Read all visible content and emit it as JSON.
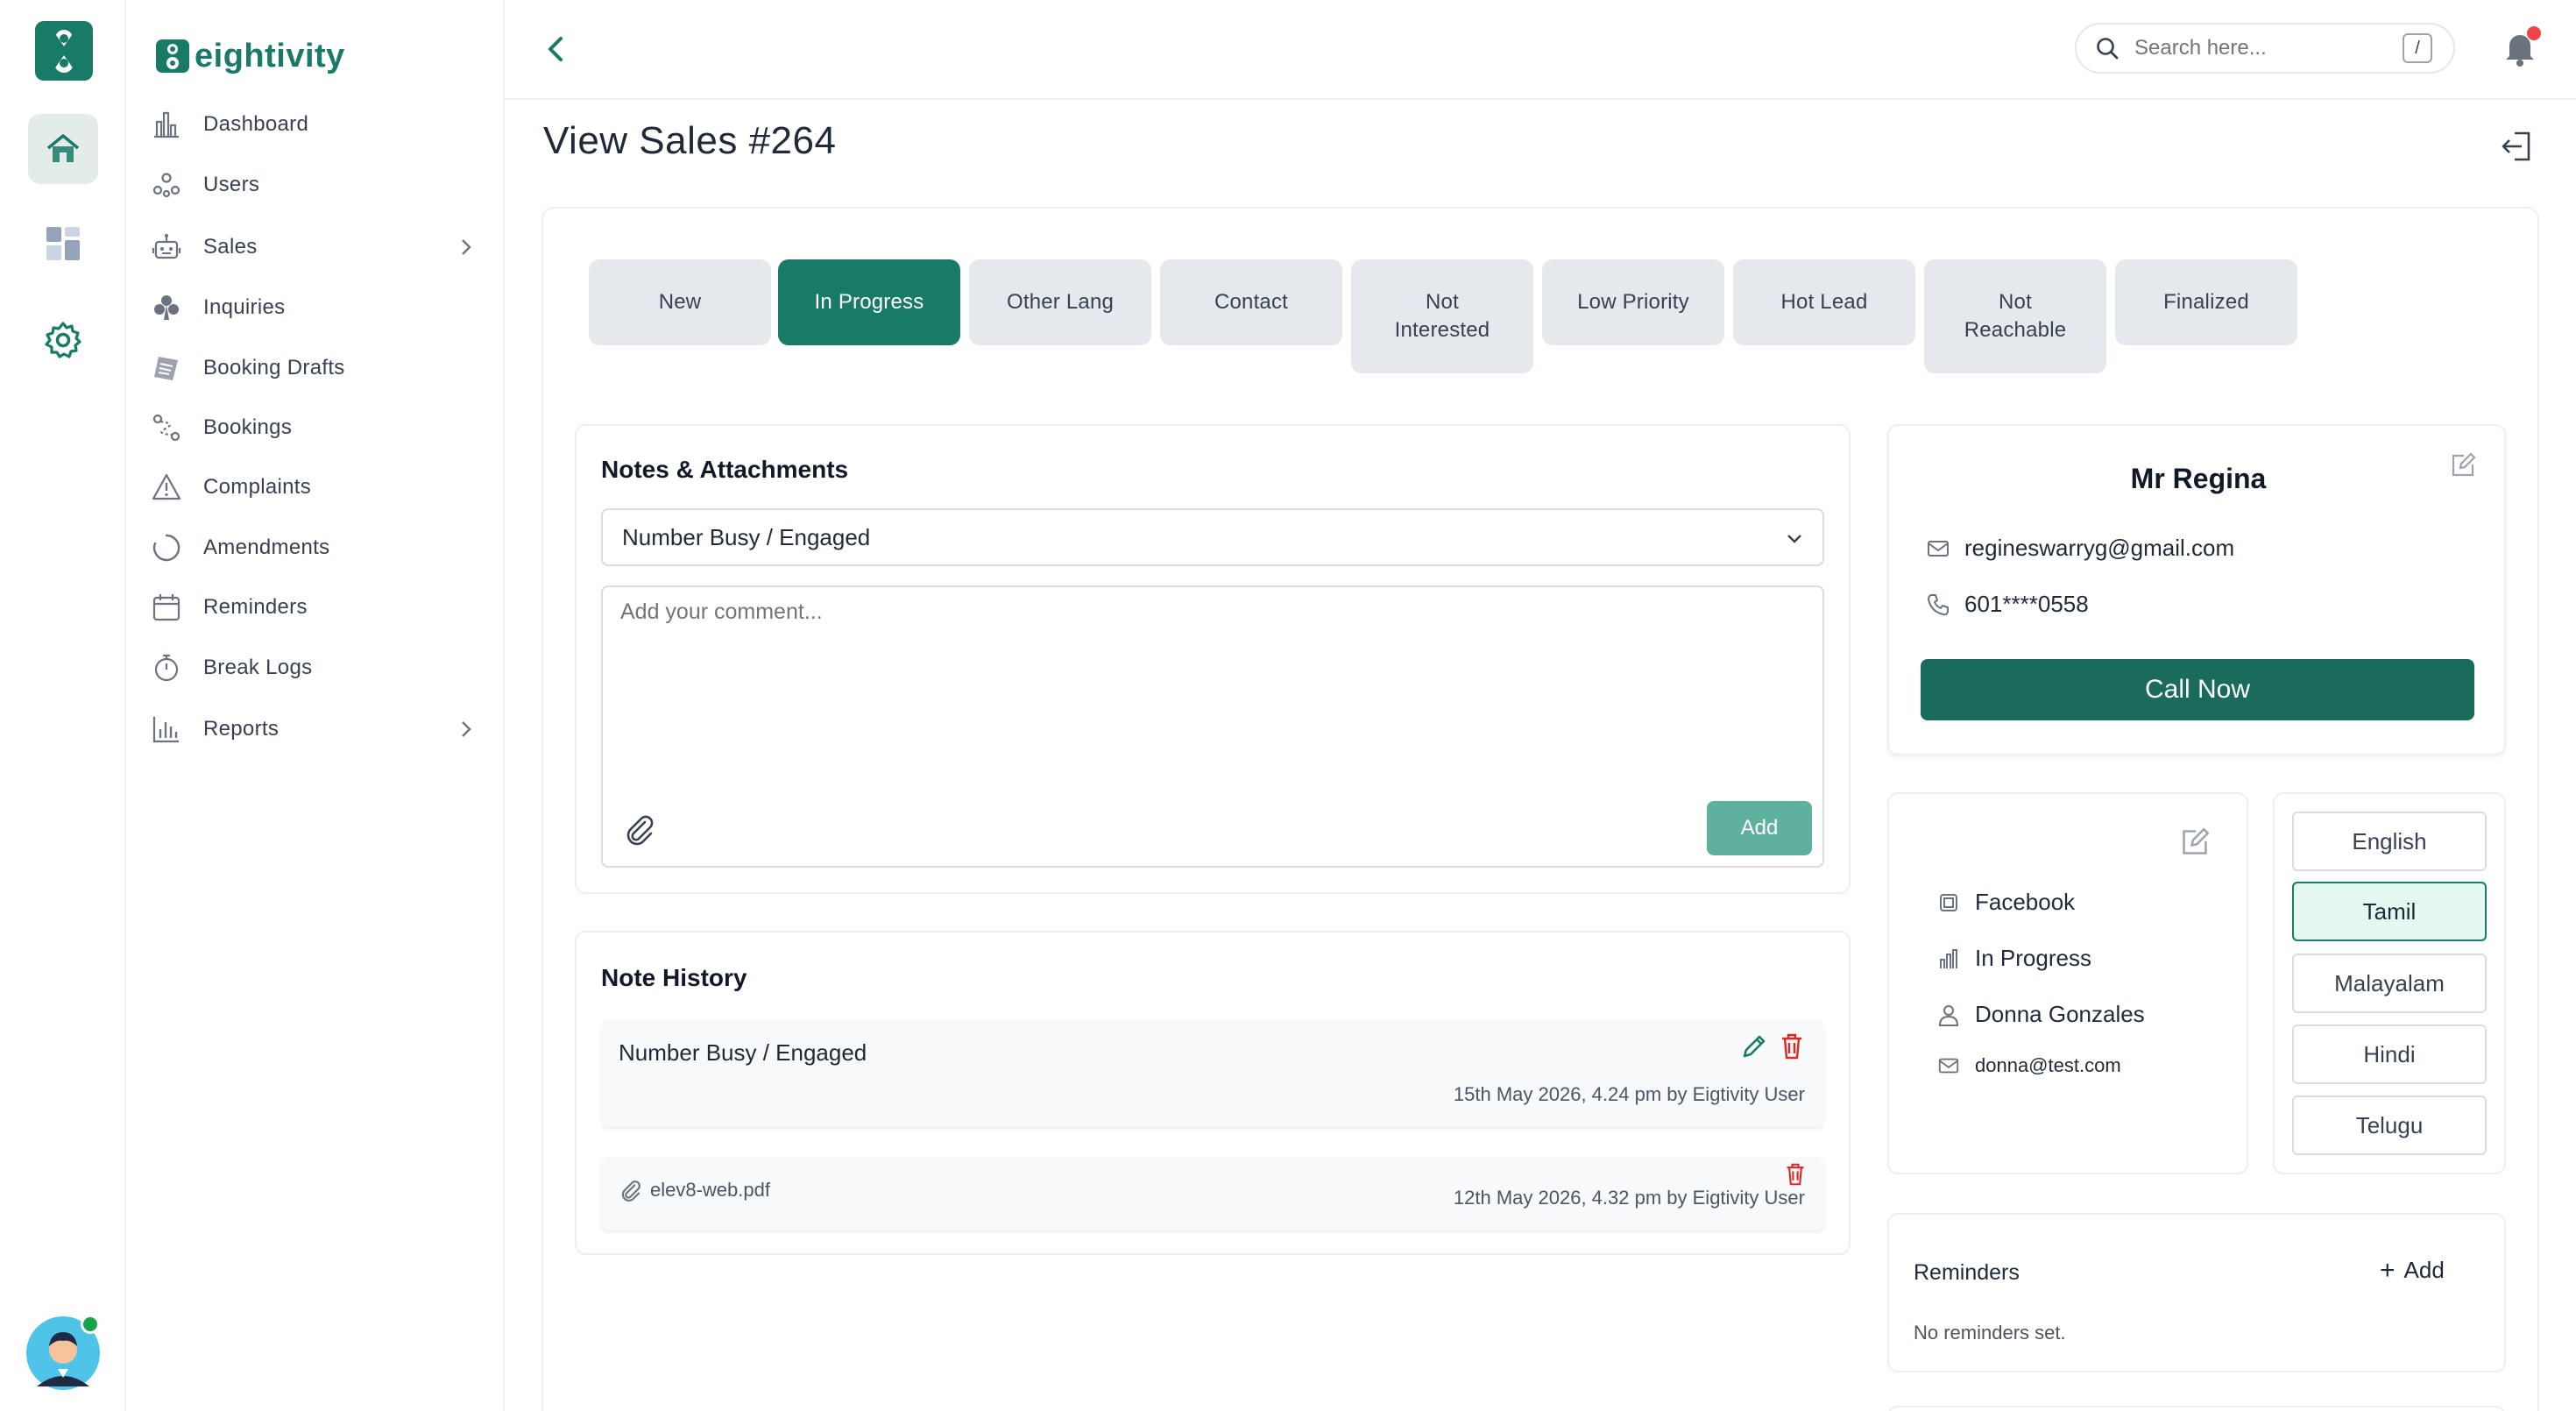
{
  "rail": {
    "logo": "eightivity-mark",
    "items": [
      {
        "icon": "home-icon",
        "active": true
      },
      {
        "icon": "grid-icon",
        "active": false
      },
      {
        "icon": "gear-icon",
        "active": false
      }
    ],
    "avatar_status": "online"
  },
  "brand": {
    "name": "eightivity"
  },
  "sidebar": {
    "items": [
      {
        "label": "Dashboard",
        "icon": "bar-chart-icon"
      },
      {
        "label": "Users",
        "icon": "users-icon"
      },
      {
        "label": "Sales",
        "icon": "robot-icon",
        "has_children": true
      },
      {
        "label": "Inquiries",
        "icon": "club-icon"
      },
      {
        "label": "Booking Drafts",
        "icon": "draft-icon"
      },
      {
        "label": "Bookings",
        "icon": "route-icon"
      },
      {
        "label": "Complaints",
        "icon": "warning-icon"
      },
      {
        "label": "Amendments",
        "icon": "spinner-icon"
      },
      {
        "label": "Reminders",
        "icon": "calendar-icon"
      },
      {
        "label": "Break Logs",
        "icon": "stopwatch-icon"
      },
      {
        "label": "Reports",
        "icon": "report-chart-icon",
        "has_children": true
      }
    ]
  },
  "header": {
    "search_placeholder": "Search here...",
    "search_shortcut": "/",
    "has_notification": true
  },
  "page": {
    "title": "View Sales #264"
  },
  "statuses": [
    {
      "label": "New",
      "active": false
    },
    {
      "label": "In Progress",
      "active": true
    },
    {
      "label": "Other Lang",
      "active": false
    },
    {
      "label": "Contact",
      "active": false
    },
    {
      "label": "Not Interested",
      "active": false
    },
    {
      "label": "Low Priority",
      "active": false
    },
    {
      "label": "Hot Lead",
      "active": false
    },
    {
      "label": "Not Reachable",
      "active": false
    },
    {
      "label": "Finalized",
      "active": false
    }
  ],
  "notes": {
    "title": "Notes & Attachments",
    "selected_reason": "Number Busy / Engaged",
    "comment_placeholder": "Add your comment...",
    "add_label": "Add"
  },
  "history": {
    "title": "Note History",
    "entries": [
      {
        "text": "Number Busy / Engaged",
        "meta": "15th May 2026, 4.24 pm by Eigtivity User"
      },
      {
        "file": "elev8-web.pdf",
        "meta": "12th May 2026, 4.32 pm by Eigtivity User"
      }
    ]
  },
  "contact": {
    "name": "Mr Regina",
    "email": "regineswarryg@gmail.com",
    "phone": "601****0558",
    "call_label": "Call Now"
  },
  "lead": {
    "source": "Facebook",
    "status": "In Progress",
    "owner": "Donna Gonzales",
    "owner_email": "donna@test.com"
  },
  "languages": {
    "options": [
      "English",
      "Tamil",
      "Malayalam",
      "Hindi",
      "Telugu"
    ],
    "selected": "Tamil"
  },
  "reminders": {
    "title": "Reminders",
    "add_label": "Add",
    "empty_text": "No reminders set."
  },
  "colors": {
    "brand": "#1a7a68",
    "brand_light": "#5fb09c",
    "danger": "#dc2626",
    "notification": "#ef4444"
  }
}
